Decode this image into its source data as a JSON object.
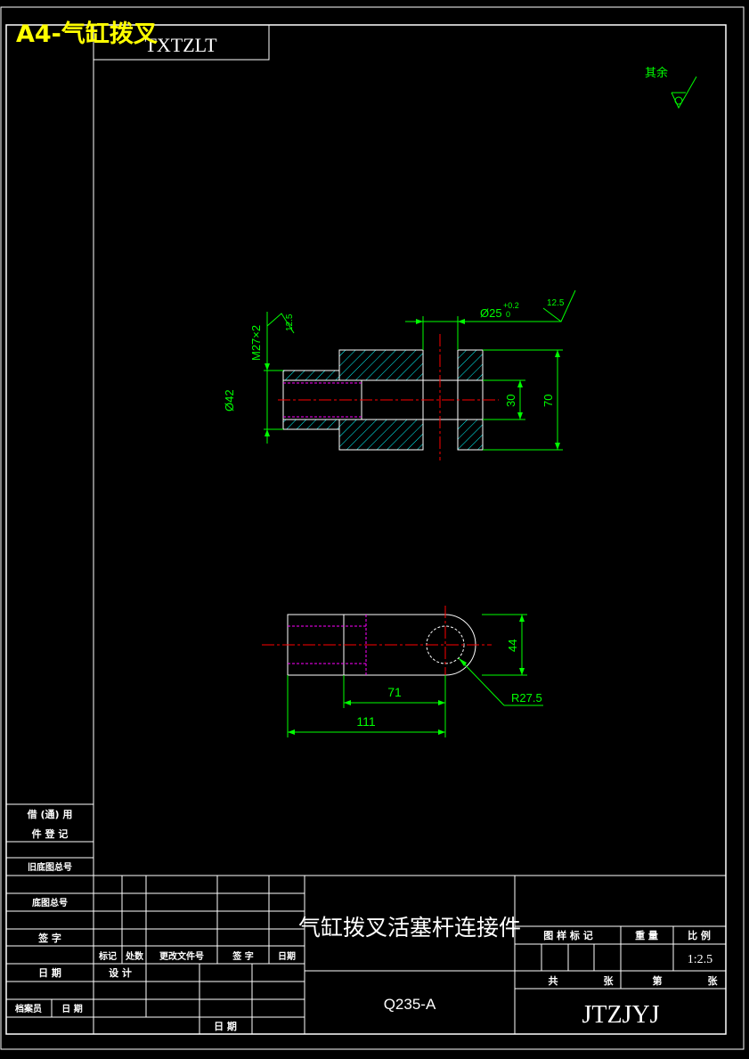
{
  "header": {
    "sheet_label": "A4-气缸拨叉",
    "drawing_code_box": "TXTZLT"
  },
  "roughness_note": {
    "label": "其余"
  },
  "front_view": {
    "thread_label": "M27×2",
    "thread_roughness": "12.5",
    "dia_outer": "Ø42",
    "hole_label": "Ø25",
    "hole_tol_upper": "+0.2",
    "hole_tol_lower": "0",
    "hole_roughness": "12.5",
    "slot_width": "30",
    "overall_height": "70"
  },
  "top_view": {
    "width": "44",
    "center_distance": "71",
    "overall_length": "111",
    "radius": "R27.5"
  },
  "left_column": {
    "used_for": "借 (通) 用",
    "register": "件 登 记",
    "old_base_no": "旧底图总号",
    "base_no": "底图总号",
    "signature": "签 字",
    "date": "日 期",
    "archivist": "档案员",
    "archivist_date": "日 期"
  },
  "title_block": {
    "part_name": "气缸拨叉活塞杆连接件",
    "material": "Q235-A",
    "drawing_number": "JTZJYJ",
    "mark_col": "标记",
    "count_col": "处数",
    "change_doc_col": "更改文件号",
    "sign_col": "签 字",
    "date_col": "日期",
    "design": "设 计",
    "date_bottom": "日 期",
    "stage_mark": "图 样 标 记",
    "weight": "重 量",
    "scale": "比 例",
    "scale_value": "1:2.5",
    "total": "共",
    "sheets": "张",
    "sheet_no": "第",
    "sheet_unit": "张"
  },
  "colors": {
    "background": "#000000",
    "frame": "#ffffff",
    "dimension": "#00ff00",
    "centerline": "#ff0000",
    "hatch": "#00ffff",
    "hidden": "#ff00ff",
    "label": "#ffff00"
  }
}
